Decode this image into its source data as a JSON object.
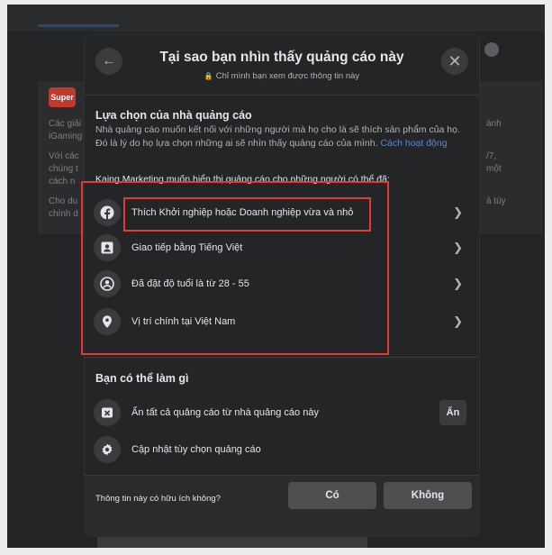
{
  "background": {
    "logo_text": "Super",
    "feed_lines": [
      "Các giải",
      "iGaming",
      "Với các",
      "chúng t",
      "cách n",
      "Cho du",
      "chính d"
    ],
    "right_fragments": [
      "ành",
      "/7,",
      "một",
      "à tùy"
    ]
  },
  "modal": {
    "title": "Tại sao bạn nhìn thấy quảng cáo này",
    "subtitle": "Chỉ mình bạn xem được thông tin này",
    "advertiser_section": {
      "title": "Lựa chọn của nhà quảng cáo",
      "description": "Nhà quảng cáo muốn kết nối với những người mà họ cho là sẽ thích sản phẩm của họ. Đó là lý do họ lựa chọn những ai sẽ nhìn thấy quảng cáo của mình.",
      "link_text": "Cách hoạt động",
      "intro": "Kaing Marketing muốn hiển thị quảng cáo cho những người có thể đã:",
      "items": [
        {
          "label": "Thích Khởi nghiệp hoặc Doanh nghiệp vừa và nhỏ",
          "icon": "facebook-icon"
        },
        {
          "label": "Giao tiếp bằng Tiếng Việt",
          "icon": "profile-card-icon"
        },
        {
          "label": "Đã đặt độ tuổi là từ 28 - 55",
          "icon": "user-circle-icon"
        },
        {
          "label": "Vị trí chính tại Việt Nam",
          "icon": "location-pin-icon"
        }
      ]
    },
    "actions_section": {
      "title": "Bạn có thể làm gì",
      "items": [
        {
          "label": "Ẩn tất cả quảng cáo từ nhà quảng cáo này",
          "icon": "hide-ad-icon",
          "button": "Ẩn"
        },
        {
          "label": "Cập nhật tùy chọn quảng cáo",
          "icon": "gear-icon"
        }
      ]
    },
    "footer": {
      "question": "Thông tin này có hữu ích không?",
      "yes": "Có",
      "no": "Không"
    }
  },
  "colors": {
    "highlight": "#e53935",
    "link": "#4e8ce4",
    "modal_bg": "#242526"
  }
}
